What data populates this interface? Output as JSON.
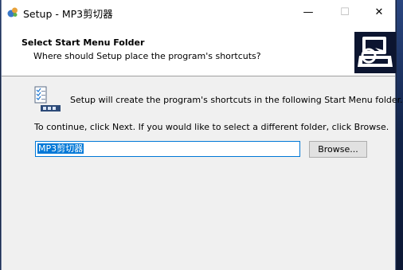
{
  "window": {
    "title": "Setup - MP3剪切器",
    "icon": "setup-app-icon",
    "controls": {
      "minimize": "—",
      "maximize": "☐",
      "close": "✕"
    }
  },
  "header": {
    "title": "Select Start Menu Folder",
    "subtitle": "Where should Setup place the program's shortcuts?",
    "image": "computer-wizard-icon"
  },
  "body": {
    "icon": "start-menu-folder-icon",
    "info_text": "Setup will create the program's shortcuts in the following Start Menu folder.",
    "continue_text": "To continue, click Next. If you would like to select a different folder, click Browse.",
    "folder_input": {
      "value": "MP3剪切器",
      "selected": true
    },
    "browse_label": "Browse..."
  },
  "colors": {
    "selection": "#0078d7",
    "window_background": "#f0f0f0",
    "header_background": "#ffffff"
  }
}
